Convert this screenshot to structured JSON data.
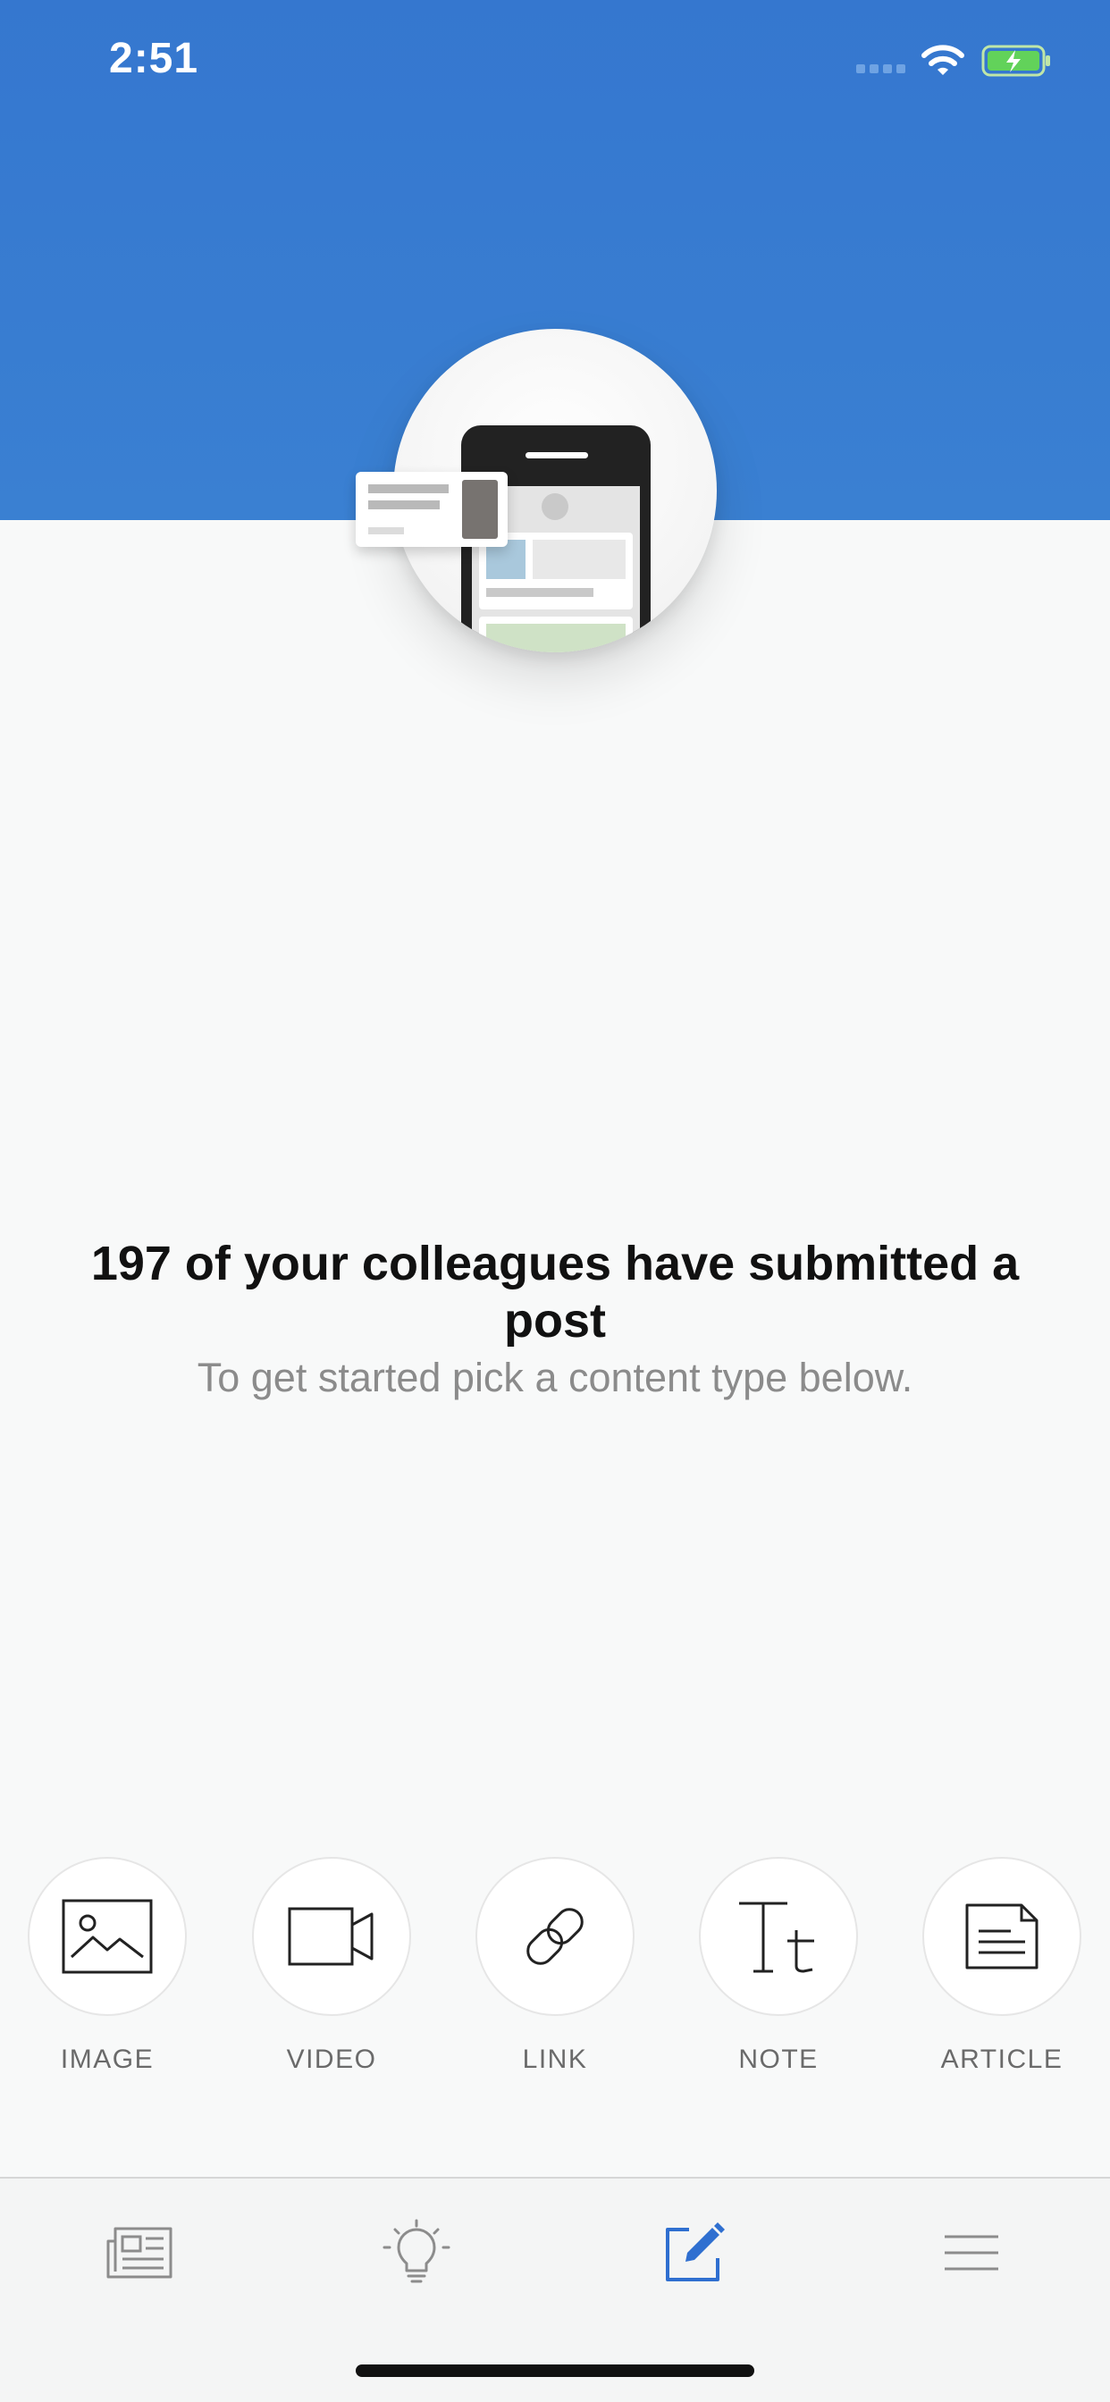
{
  "status_bar": {
    "time": "2:51"
  },
  "hero": {
    "headline": "197 of your colleagues have submitted a post",
    "subline": "To get started pick a content type below."
  },
  "content_types": [
    {
      "label": "IMAGE",
      "icon": "image-icon"
    },
    {
      "label": "VIDEO",
      "icon": "video-icon"
    },
    {
      "label": "LINK",
      "icon": "link-icon"
    },
    {
      "label": "NOTE",
      "icon": "note-text-icon"
    },
    {
      "label": "ARTICLE",
      "icon": "article-icon"
    }
  ],
  "tab_bar": {
    "items": [
      {
        "icon": "newspaper-icon",
        "selected": false
      },
      {
        "icon": "lightbulb-icon",
        "selected": false
      },
      {
        "icon": "compose-icon",
        "selected": true
      },
      {
        "icon": "menu-icon",
        "selected": false
      }
    ]
  },
  "colors": {
    "header_blue": "#3577cf",
    "accent_blue": "#2f6fd0",
    "icon_dark": "#222222",
    "icon_gray": "#8c8c8c",
    "label_gray": "#6a6a6a"
  }
}
